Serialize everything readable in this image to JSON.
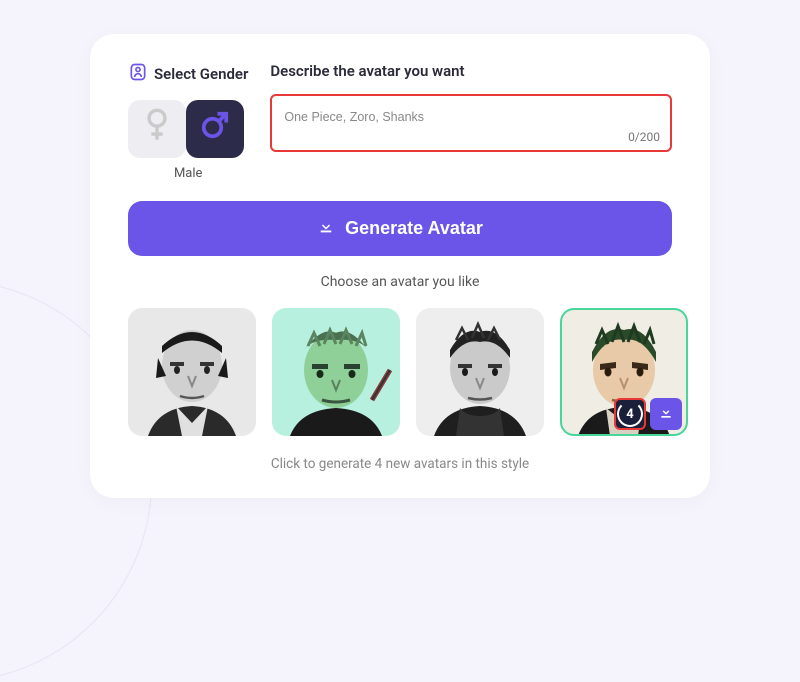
{
  "gender": {
    "title": "Select Gender",
    "selected_label": "Male"
  },
  "describe": {
    "title": "Describe the avatar you want",
    "value": "One Piece, Zoro, Shanks",
    "char_count": "0/200"
  },
  "generate_button": "Generate Avatar",
  "choose_text": "Choose an avatar you like",
  "regen_count": "4",
  "footer_text": "Click to generate 4 new avatars in this style"
}
